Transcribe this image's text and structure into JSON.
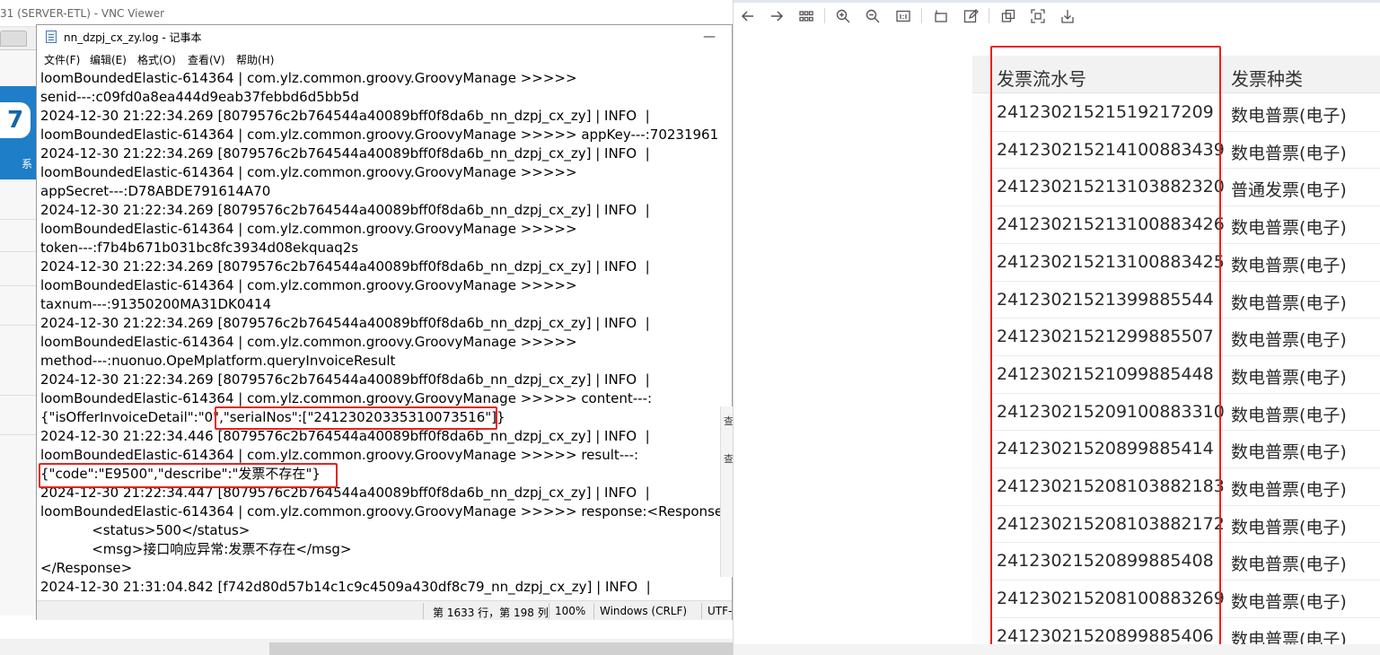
{
  "vnc": {
    "title": "31 (SERVER-ETL) - VNC Viewer",
    "desktop_icon_label": "系"
  },
  "notepad": {
    "title": "nn_dzpj_cx_zy.log - 记事本",
    "menu": [
      "文件(F)",
      "编辑(E)",
      "格式(O)",
      "查看(V)",
      "帮助(H)"
    ],
    "lines": [
      "loomBoundedElastic-614364 | com.ylz.common.groovy.GroovyManage >>>>>",
      "senid---:c09fd0a8ea444d9eab37febbd6d5bb5d",
      "2024-12-30 21:22:34.269 [8079576c2b764544a40089bff0f8da6b_nn_dzpj_cx_zy] | INFO  |",
      "loomBoundedElastic-614364 | com.ylz.common.groovy.GroovyManage >>>>> appKey---:70231961",
      "2024-12-30 21:22:34.269 [8079576c2b764544a40089bff0f8da6b_nn_dzpj_cx_zy] | INFO  |",
      "loomBoundedElastic-614364 | com.ylz.common.groovy.GroovyManage >>>>>",
      "appSecret---:D78ABDE791614A70",
      "2024-12-30 21:22:34.269 [8079576c2b764544a40089bff0f8da6b_nn_dzpj_cx_zy] | INFO  |",
      "loomBoundedElastic-614364 | com.ylz.common.groovy.GroovyManage >>>>>",
      "token---:f7b4b671b031bc8fc3934d08ekquaq2s",
      "2024-12-30 21:22:34.269 [8079576c2b764544a40089bff0f8da6b_nn_dzpj_cx_zy] | INFO  |",
      "loomBoundedElastic-614364 | com.ylz.common.groovy.GroovyManage >>>>>",
      "taxnum---:91350200MA31DK0414",
      "2024-12-30 21:22:34.269 [8079576c2b764544a40089bff0f8da6b_nn_dzpj_cx_zy] | INFO  |",
      "loomBoundedElastic-614364 | com.ylz.common.groovy.GroovyManage >>>>>",
      "method---:nuonuo.OpeMplatform.queryInvoiceResult",
      "2024-12-30 21:22:34.269 [8079576c2b764544a40089bff0f8da6b_nn_dzpj_cx_zy] | INFO  |",
      "loomBoundedElastic-614364 | com.ylz.common.groovy.GroovyManage >>>>> content---:",
      "{\"isOfferInvoiceDetail\":\"0\",\"serialNos\":[\"24123020335310073516\"]}",
      "2024-12-30 21:22:34.446 [8079576c2b764544a40089bff0f8da6b_nn_dzpj_cx_zy] | INFO  |",
      "loomBoundedElastic-614364 | com.ylz.common.groovy.GroovyManage >>>>> result---:",
      "{\"code\":\"E9500\",\"describe\":\"发票不存在\"}",
      "2024-12-30 21:22:34.447 [8079576c2b764544a40089bff0f8da6b_nn_dzpj_cx_zy] | INFO  |",
      "loomBoundedElastic-614364 | com.ylz.common.groovy.GroovyManage >>>>> response:<Response>",
      "            <status>500</status>",
      "            <msg>接口响应异常:发票不存在</msg>",
      "</Response>",
      "2024-12-30 21:31:04.842 [f742d80d57b14c1c9c4509a430df8c79_nn_dzpj_cx_zy] | INFO  |"
    ],
    "side_glyphs": [
      "查",
      "查"
    ],
    "status": {
      "position": "第 1633 行，第 198 列",
      "zoom": "100%",
      "line_ending": "Windows (CRLF)",
      "encoding": "UTF-"
    }
  },
  "viewer": {
    "toolbar_icons": [
      "back-icon",
      "forward-icon",
      "grid-icon",
      "zoom-in-icon",
      "zoom-out-icon",
      "actual-size-icon",
      "rotate-icon",
      "edit-icon",
      "copy-icon",
      "fit-screen-icon",
      "save-icon"
    ],
    "table": {
      "headers": [
        "发票流水号",
        "发票种类"
      ],
      "rows": [
        [
          "24123021521519217209",
          "数电普票(电子)"
        ],
        [
          "24123021521410088343​9",
          "数电普票(电子)"
        ],
        [
          "24123021521310388232​0",
          "普通发票(电子)"
        ],
        [
          "24123021521310088342​6",
          "数电普票(电子)"
        ],
        [
          "24123021521310088342​5",
          "数电普票(电子)"
        ],
        [
          "24123021521399885544",
          "数电普票(电子)"
        ],
        [
          "24123021521299885507",
          "数电普票(电子)"
        ],
        [
          "24123021521099885448",
          "数电普票(电子)"
        ],
        [
          "24123021520910088331​0",
          "数电普票(电子)"
        ],
        [
          "24123021520899885414",
          "数电普票(电子)"
        ],
        [
          "24123021520810388218​3",
          "数电普票(电子)"
        ],
        [
          "24123021520810388217​2",
          "数电普票(电子)"
        ],
        [
          "24123021520899885408",
          "数电普票(电子)"
        ],
        [
          "24123021520810088326​9",
          "数电普票(电子)"
        ],
        [
          "24123021520899885406",
          "数电普票(电子)"
        ]
      ]
    }
  },
  "colors": {
    "highlight_red": "#e8221c",
    "desktop_blue": "#1e7ec7"
  }
}
